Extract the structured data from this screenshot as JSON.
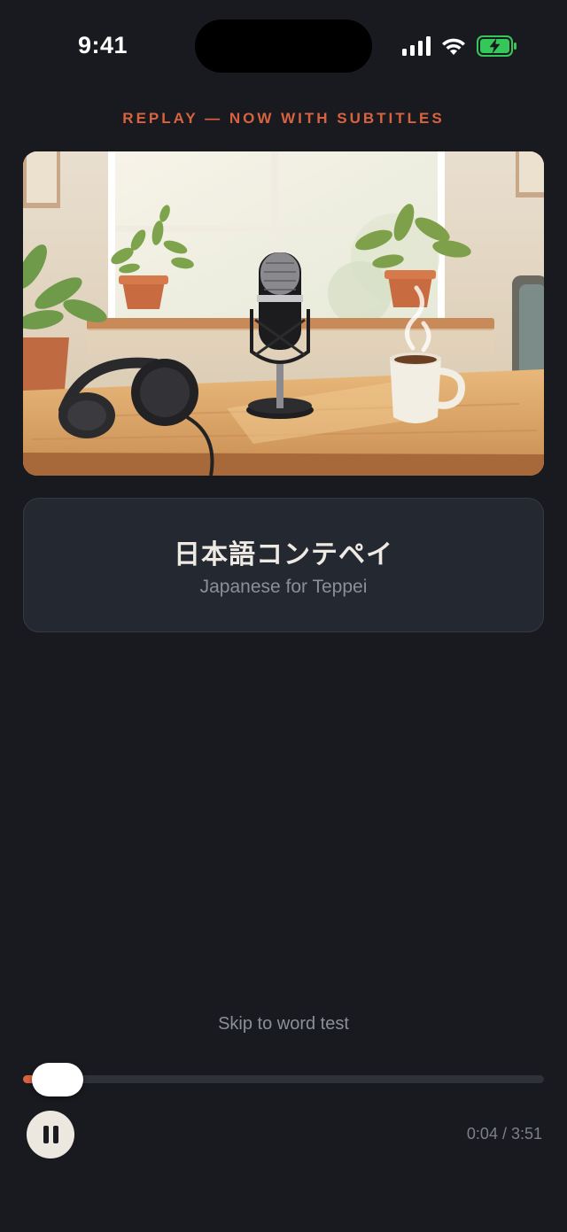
{
  "status_bar": {
    "time": "9:41",
    "icons": [
      "signal-icon",
      "wifi-icon",
      "battery-charging-icon"
    ]
  },
  "banner": {
    "text": "REPLAY — NOW WITH SUBTITLES",
    "color": "#d9623f"
  },
  "artwork": {
    "subject": "podcast-artwork"
  },
  "episode": {
    "title": "日本語コンテペイ",
    "subtitle": "Japanese for Teppei"
  },
  "skip_link": "Skip to word test",
  "player": {
    "state": "playing",
    "progress_fraction": 0.017,
    "time_display": "0:04 / 3:51",
    "accent": "#d9623f",
    "button_icon": "pause-icon"
  },
  "colors": {
    "background": "#181a1f",
    "card": "#232831"
  }
}
